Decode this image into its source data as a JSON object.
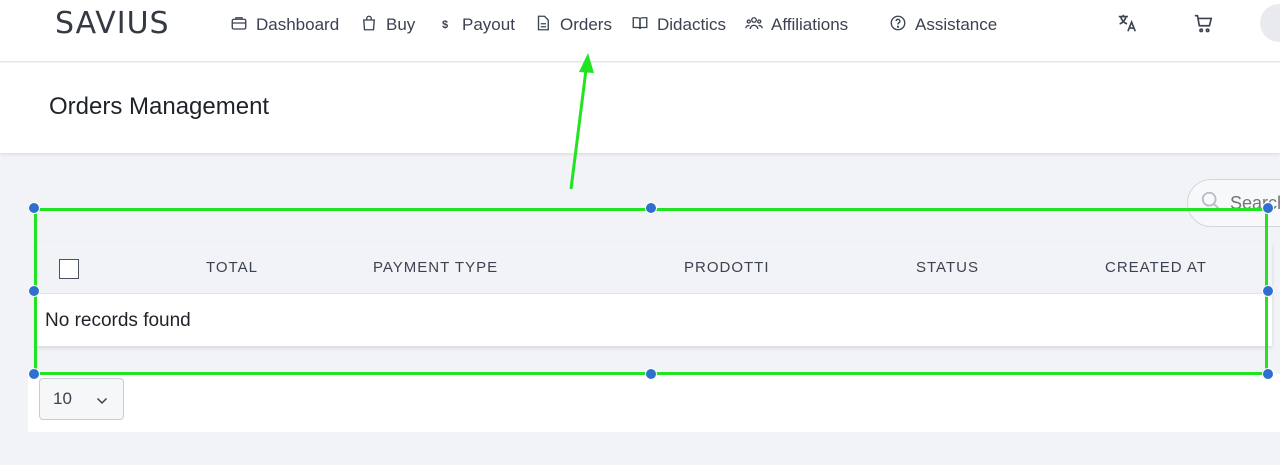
{
  "brand": {
    "logo": "SAVIUS"
  },
  "nav": {
    "items": [
      {
        "label": "Dashboard",
        "icon": "briefcase-icon"
      },
      {
        "label": "Buy",
        "icon": "shopping-bag-icon"
      },
      {
        "label": "Payout",
        "icon": "dollar-icon"
      },
      {
        "label": "Orders",
        "icon": "document-icon"
      },
      {
        "label": "Didactics",
        "icon": "book-icon"
      },
      {
        "label": "Affiliations",
        "icon": "users-icon"
      },
      {
        "label": "Assistance",
        "icon": "help-circle-icon"
      }
    ],
    "dollar_glyph": "$"
  },
  "header": {
    "title": "Orders Management"
  },
  "search": {
    "placeholder": "Search"
  },
  "table": {
    "columns": [
      "TOTAL",
      "PAYMENT TYPE",
      "PRODOTTI",
      "STATUS",
      "CREATED AT"
    ],
    "empty_message": "No records found"
  },
  "pagination": {
    "page_size": "10"
  },
  "annotation": {
    "box_color": "#22e322",
    "handle_color": "#2f6fd0",
    "arrow_color": "#22e322"
  }
}
